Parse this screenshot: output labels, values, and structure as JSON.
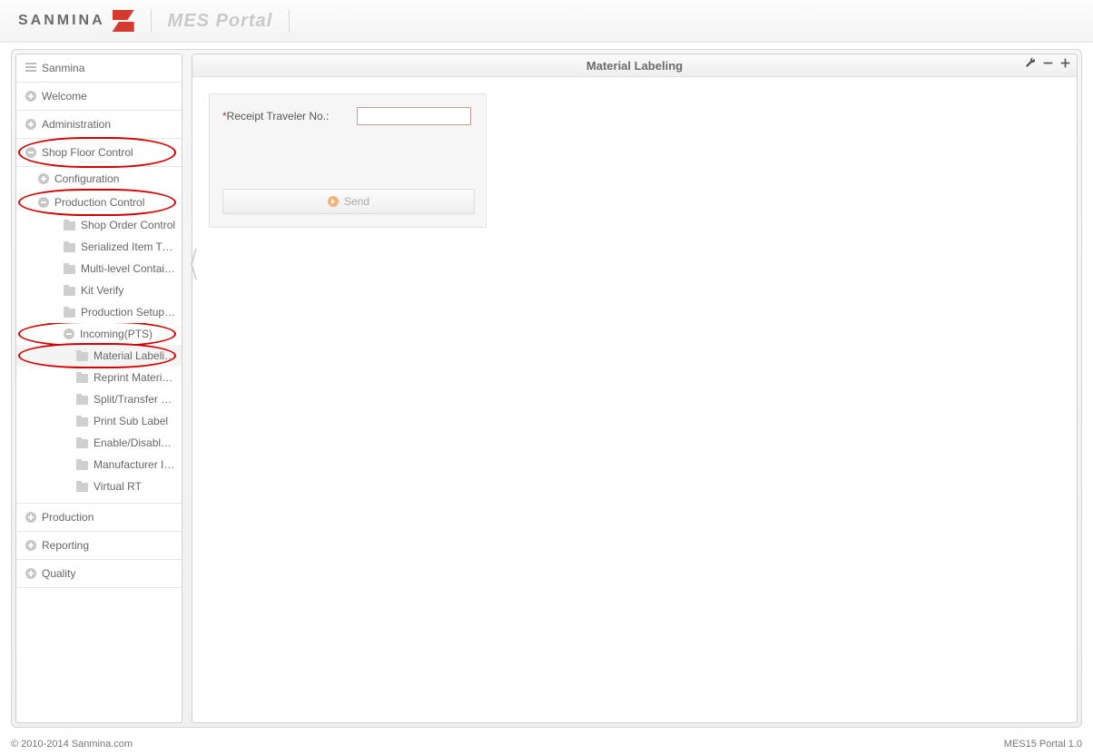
{
  "header": {
    "brand": "SANMINA",
    "portal_title": "MES Portal"
  },
  "sidebar": {
    "root": "Sanmina",
    "items": [
      {
        "label": "Welcome"
      },
      {
        "label": "Administration"
      },
      {
        "label": "Shop Floor Control",
        "open": true,
        "children": [
          {
            "label": "Configuration"
          },
          {
            "label": "Production Control",
            "open": true,
            "children": [
              {
                "label": "Shop Order Control"
              },
              {
                "label": "Serialized Item Tracker"
              },
              {
                "label": "Multi-level Container Pack."
              },
              {
                "label": "Kit Verify"
              },
              {
                "label": "Production Setup(PTS)"
              },
              {
                "label": "Incoming(PTS)",
                "open": true,
                "children": [
                  {
                    "label": "Material Labeling",
                    "selected": true
                  },
                  {
                    "label": "Reprint Material Label"
                  },
                  {
                    "label": "Split/Transfer Material"
                  },
                  {
                    "label": "Print Sub Label"
                  },
                  {
                    "label": "Enable/Disable AML"
                  },
                  {
                    "label": "Manufacturer Info"
                  },
                  {
                    "label": "Virtual RT"
                  }
                ]
              }
            ]
          }
        ]
      },
      {
        "label": "Production"
      },
      {
        "label": "Reporting"
      },
      {
        "label": "Quality"
      }
    ]
  },
  "main": {
    "title": "Material Labeling",
    "form": {
      "field_label_prefix": "*",
      "field_label": "Receipt Traveler No.:",
      "field_value": "",
      "send_label": "Send"
    }
  },
  "footer": {
    "left": "© 2010-2014 Sanmina.com",
    "right": "MES15 Portal 1.0"
  }
}
